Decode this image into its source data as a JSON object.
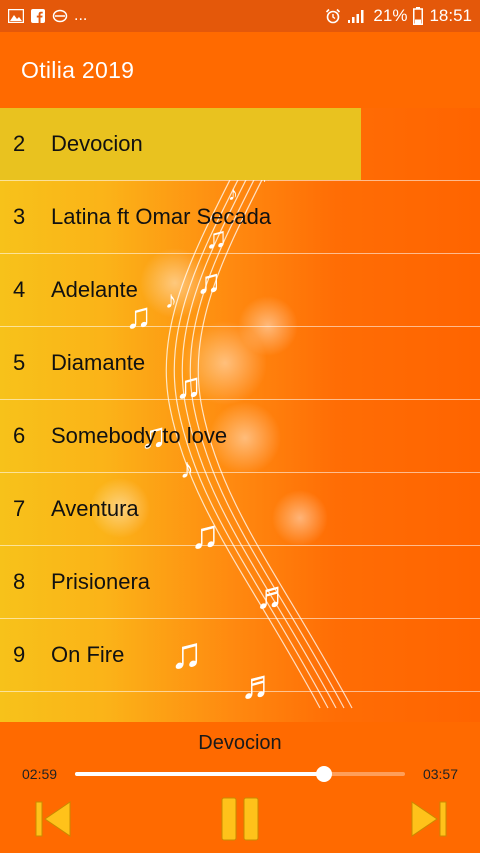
{
  "status_bar": {
    "overflow": "...",
    "battery": "21%",
    "time": "18:51",
    "icons": [
      "gallery-icon",
      "facebook-icon",
      "sync-icon",
      "alarm-icon",
      "signal-icon",
      "battery-icon"
    ]
  },
  "app_bar": {
    "title": "Otilia 2019"
  },
  "tracks": [
    {
      "num": "2",
      "title": "Devocion",
      "selected": true
    },
    {
      "num": "3",
      "title": "Latina ft Omar Secada"
    },
    {
      "num": "4",
      "title": "Adelante"
    },
    {
      "num": "5",
      "title": "Diamante"
    },
    {
      "num": "6",
      "title": "Somebody to love"
    },
    {
      "num": "7",
      "title": "Aventura"
    },
    {
      "num": "8",
      "title": "Prisionera"
    },
    {
      "num": "9",
      "title": "On Fire"
    }
  ],
  "player": {
    "now_playing": "Devocion",
    "elapsed": "02:59",
    "duration": "03:57",
    "progress": 0.755,
    "controls": [
      "previous-icon",
      "pause-icon",
      "next-icon"
    ]
  },
  "colors": {
    "primary": "#ff6a00",
    "status_bar": "#e4580a",
    "selected_row": "#e9c21f",
    "control_gold": "#ffc21a"
  }
}
